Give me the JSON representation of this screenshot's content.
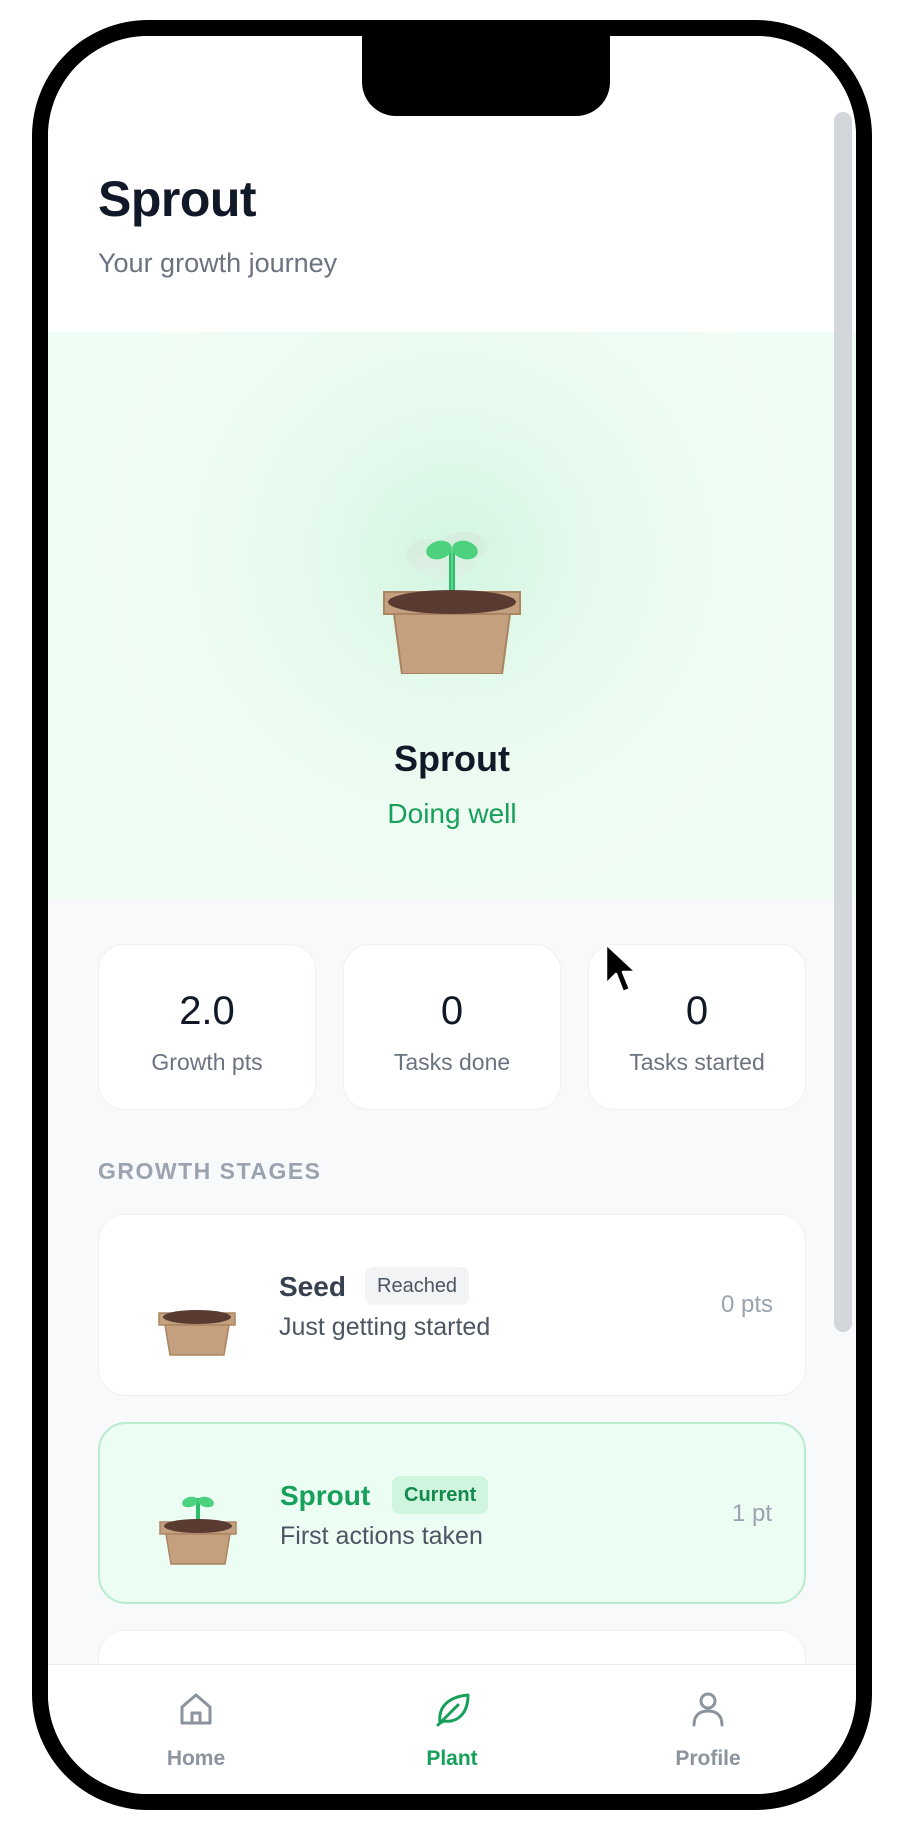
{
  "header": {
    "title": "Sprout",
    "subtitle": "Your growth journey"
  },
  "hero": {
    "plant_name": "Sprout",
    "status": "Doing well"
  },
  "stats": [
    {
      "value": "2.0",
      "label": "Growth pts"
    },
    {
      "value": "0",
      "label": "Tasks done"
    },
    {
      "value": "0",
      "label": "Tasks started"
    }
  ],
  "stages_section": {
    "label": "GROWTH STAGES",
    "items": [
      {
        "name": "Seed",
        "badge": "Reached",
        "description": "Just getting started",
        "points": "0 pts"
      },
      {
        "name": "Sprout",
        "badge": "Current",
        "description": "First actions taken",
        "points": "1 pt"
      }
    ]
  },
  "nav": {
    "items": [
      {
        "label": "Home",
        "icon": "home-icon"
      },
      {
        "label": "Plant",
        "icon": "leaf-icon",
        "active": true
      },
      {
        "label": "Profile",
        "icon": "user-icon"
      }
    ]
  },
  "colors": {
    "accent": "#16a05a",
    "hero_bg": "#f0fdf5",
    "pot": "#c4a07f",
    "soil": "#5a3b32"
  }
}
